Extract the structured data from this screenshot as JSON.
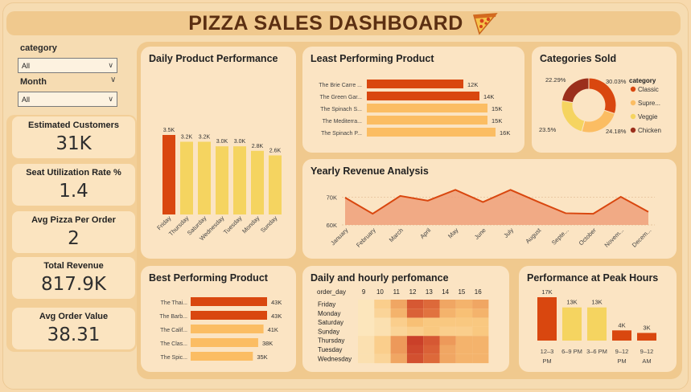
{
  "header": {
    "title": "PIZZA SALES DASHBOARD",
    "icon": "pizza-slice-icon"
  },
  "slicers": {
    "category": {
      "label": "category",
      "value": "All"
    },
    "month": {
      "label": "Month",
      "value": "All"
    }
  },
  "kpis": [
    {
      "label": "Estimated Customers",
      "value": "31K"
    },
    {
      "label": "Seat Utilization Rate %",
      "value": "1.4"
    },
    {
      "label": "Avg Pizza Per Order",
      "value": "2"
    },
    {
      "label": "Total Revenue",
      "value": "817.9K"
    },
    {
      "label": "Avg Order Value",
      "value": "38.31"
    }
  ],
  "colors": {
    "dark": "#d9470f",
    "light": "#f5d460",
    "mid": "#fbbd63",
    "chicken": "#9b2f1c",
    "area": "#eea07a",
    "line": "#d9470f"
  },
  "chart_data": [
    {
      "id": "daily",
      "type": "bar",
      "title": "Daily Product Performance",
      "categories": [
        "Friday",
        "Thursday",
        "Saturday",
        "Wednesday",
        "Tuesday",
        "Monday",
        "Sunday"
      ],
      "values": [
        3.5,
        3.2,
        3.2,
        3.0,
        3.0,
        2.8,
        2.6
      ],
      "labels": [
        "3.5K",
        "3.2K",
        "3.2K",
        "3.0K",
        "3.0K",
        "2.8K",
        "2.6K"
      ],
      "highlight_index": 0
    },
    {
      "id": "least",
      "type": "bar",
      "orientation": "horizontal",
      "title": "Least Performing Product",
      "categories": [
        "The Brie Carre ...",
        "The Green Gar...",
        "The Spinach S...",
        "The Mediterra...",
        "The Spinach P..."
      ],
      "values": [
        12,
        14,
        15,
        15,
        16
      ],
      "labels": [
        "12K",
        "14K",
        "15K",
        "15K",
        "16K"
      ],
      "highlight_count": 2
    },
    {
      "id": "categories",
      "type": "pie",
      "title": "Categories Sold",
      "legend_title": "category",
      "categories": [
        "Classic",
        "Supre...",
        "Veggie",
        "Chicken"
      ],
      "values": [
        30.03,
        24.18,
        23.5,
        22.29
      ],
      "labels": [
        "30.03%",
        "24.18%",
        "23.5%",
        "22.29%"
      ]
    },
    {
      "id": "yearly",
      "type": "area",
      "title": "Yearly Revenue Analysis",
      "x": [
        "January",
        "February",
        "March",
        "April",
        "May",
        "June",
        "July",
        "August",
        "Septe...",
        "October",
        "Novem...",
        "Decem..."
      ],
      "values": [
        69.8,
        64.0,
        70.4,
        68.7,
        72.6,
        68.2,
        72.6,
        68.3,
        64.2,
        64.0,
        70.1,
        64.7
      ],
      "yticks": [
        "60K",
        "70K"
      ],
      "ylim": [
        60,
        75
      ]
    },
    {
      "id": "best",
      "type": "bar",
      "orientation": "horizontal",
      "title": "Best Performing Product",
      "categories": [
        "The Thai...",
        "The Barb...",
        "The Calif...",
        "The Clas...",
        "The Spic..."
      ],
      "values": [
        43,
        43,
        41,
        38,
        35
      ],
      "labels": [
        "43K",
        "43K",
        "41K",
        "38K",
        "35K"
      ],
      "highlight_count": 2
    },
    {
      "id": "heatmap",
      "type": "heatmap",
      "title": "Daily and hourly perfomance",
      "row_header": "order_day",
      "columns": [
        "9",
        "10",
        "11",
        "12",
        "13",
        "14",
        "15",
        "16"
      ],
      "rows": [
        "Friday",
        "Monday",
        "Saturday",
        "Sunday",
        "Thursday",
        "Tuesday",
        "Wednesday"
      ],
      "values": [
        [
          0.05,
          0.25,
          0.45,
          0.8,
          0.7,
          0.45,
          0.4,
          0.45
        ],
        [
          0.05,
          0.2,
          0.4,
          0.75,
          0.65,
          0.4,
          0.35,
          0.4
        ],
        [
          0.05,
          0.1,
          0.25,
          0.35,
          0.3,
          0.3,
          0.3,
          0.3
        ],
        [
          0.05,
          0.1,
          0.2,
          0.25,
          0.3,
          0.25,
          0.25,
          0.3
        ],
        [
          0.1,
          0.25,
          0.5,
          0.95,
          0.8,
          0.5,
          0.4,
          0.4
        ],
        [
          0.1,
          0.25,
          0.5,
          0.9,
          0.75,
          0.45,
          0.4,
          0.4
        ],
        [
          0.1,
          0.2,
          0.45,
          0.85,
          0.7,
          0.45,
          0.4,
          0.4
        ]
      ]
    },
    {
      "id": "peak",
      "type": "bar",
      "title": "Performance at Peak Hours",
      "categories": [
        "12–3 PM",
        "6–9 PM",
        "3–6 PM",
        "9–12 PM",
        "9–12 AM"
      ],
      "category_lines": [
        [
          "12–3",
          "PM"
        ],
        [
          "6–9 PM"
        ],
        [
          "3–6 PM"
        ],
        [
          "9–12",
          "PM"
        ],
        [
          "9–12",
          "AM"
        ]
      ],
      "values": [
        17,
        13,
        13,
        4,
        3
      ],
      "labels": [
        "17K",
        "13K",
        "13K",
        "4K",
        "3K"
      ],
      "colors": [
        "dark",
        "light",
        "light",
        "dark",
        "dark"
      ]
    }
  ]
}
